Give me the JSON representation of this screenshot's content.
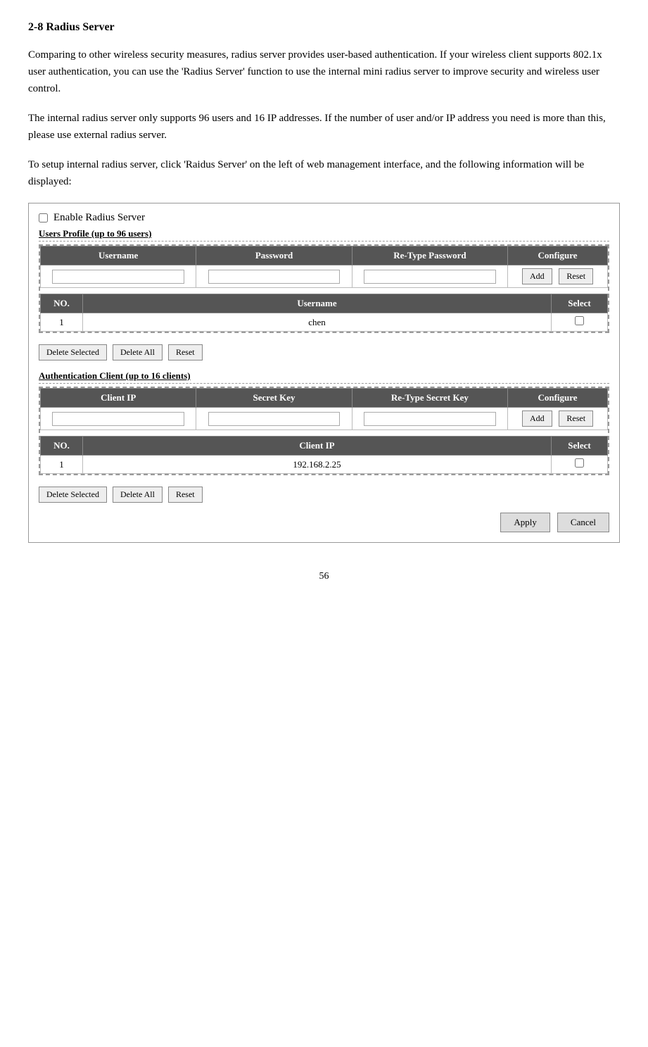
{
  "page": {
    "title": "2-8 Radius Server",
    "paragraphs": [
      "Comparing to other wireless security measures, radius server provides user-based authentication. If your wireless client supports 802.1x user authentication, you can use the 'Radius Server' function to use the internal mini radius server to improve security and wireless user control.",
      "The internal radius server only supports 96 users and 16 IP addresses. If the number of user and/or IP address you need is more than this, please use external radius server.",
      "To setup internal radius server, click 'Raidus Server' on the left of web management interface, and the following information will be displayed:"
    ],
    "page_number": "56"
  },
  "ui": {
    "enable_label": "Enable Radius Server",
    "users_profile_title": "Users Profile (up to 96 users)",
    "users_table": {
      "headers": [
        "Username",
        "Password",
        "Re-Type Password",
        "Configure"
      ],
      "configure_buttons": [
        "Add",
        "Reset"
      ],
      "list_headers": [
        "NO.",
        "Username",
        "Select"
      ],
      "list_rows": [
        {
          "no": "1",
          "username": "chen",
          "select": false
        }
      ]
    },
    "users_actions": [
      "Delete Selected",
      "Delete All",
      "Reset"
    ],
    "auth_client_title": "Authentication Client (up to 16 clients)",
    "auth_table": {
      "headers": [
        "Client IP",
        "Secret Key",
        "Re-Type Secret Key",
        "Configure"
      ],
      "configure_buttons": [
        "Add",
        "Reset"
      ],
      "list_headers": [
        "NO.",
        "Client IP",
        "Select"
      ],
      "list_rows": [
        {
          "no": "1",
          "client_ip": "192.168.2.25",
          "select": false
        }
      ]
    },
    "auth_actions": [
      "Delete Selected",
      "Delete All",
      "Reset"
    ],
    "bottom_buttons": [
      "Apply",
      "Cancel"
    ]
  }
}
